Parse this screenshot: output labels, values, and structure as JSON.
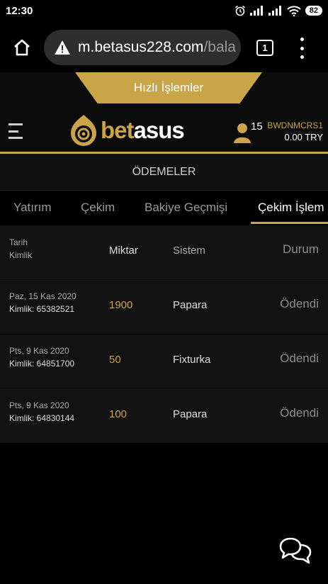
{
  "status_bar": {
    "time": "12:30",
    "battery": "82",
    "icons": [
      "alarm-icon",
      "signal-icon",
      "signal-icon",
      "wifi-icon",
      "battery-icon"
    ]
  },
  "browser": {
    "url_main": "m.betasus228.com",
    "url_rest": "/bala",
    "tab_count": "1",
    "icons": [
      "home-icon",
      "warning-icon",
      "more-vert-icon"
    ]
  },
  "site": {
    "quick_actions_label": "Hızlı İşlemler",
    "logo": {
      "part1": "bet",
      "part2": "asus"
    },
    "user": {
      "count": "15",
      "username": "BWDNMCRS1",
      "balance": "0.00 TRY"
    },
    "accent_color": "#c9a449"
  },
  "page": {
    "section_title": "ÖDEMELER",
    "tabs": [
      "Yatırım",
      "Çekim",
      "Bakiye Geçmişi",
      "Çekim İşlem"
    ],
    "active_tab": "Çekim İşlem"
  },
  "table": {
    "headers": {
      "date": "Tarih",
      "id": "Kimlik",
      "amount": "Miktar",
      "system": "Sistem",
      "status": "Durum"
    },
    "rows": [
      {
        "date": "Paz, 15 Kas 2020",
        "id": "Kimlik: 65382521",
        "amount": "1900",
        "system": "Papara",
        "status": "Ödendi"
      },
      {
        "date": "Pts, 9 Kas 2020",
        "id": "Kimlik: 64851700",
        "amount": "50",
        "system": "Fixturka",
        "status": "Ödendi"
      },
      {
        "date": "Pts, 9 Kas 2020",
        "id": "Kimlik: 64830144",
        "amount": "100",
        "system": "Papara",
        "status": "Ödendi"
      }
    ]
  }
}
